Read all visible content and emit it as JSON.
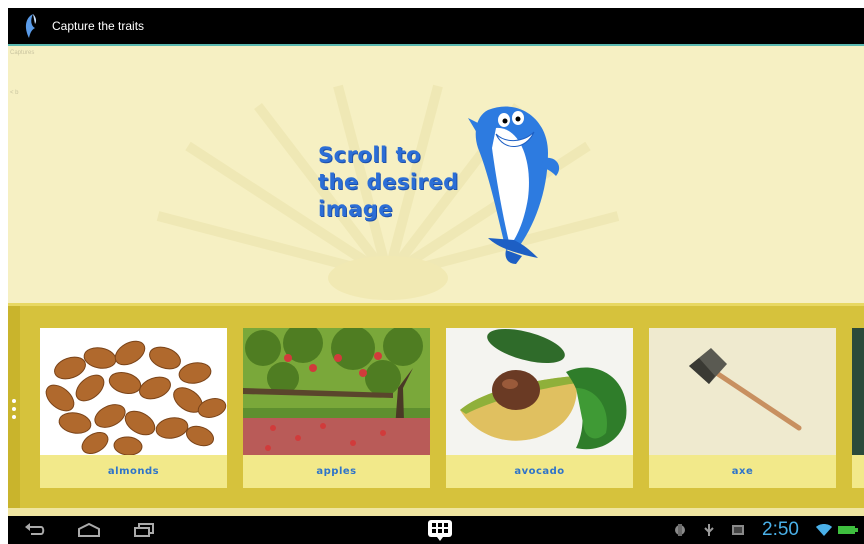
{
  "actionbar": {
    "title": "Capture the traits",
    "icon": "dolphin-app-icon"
  },
  "ghost": {
    "top_text": "Captures",
    "side_text": "< b"
  },
  "hero": {
    "lines": [
      "Scroll to",
      "the desired",
      "image"
    ],
    "mascot": "shark-mascot"
  },
  "cards": [
    {
      "label": "almonds",
      "image": "almonds-photo"
    },
    {
      "label": "apples",
      "image": "apple-tree-photo"
    },
    {
      "label": "avocado",
      "image": "avocado-photo"
    },
    {
      "label": "axe",
      "image": "axe-photo"
    }
  ],
  "statusbar": {
    "time": "2:50"
  },
  "colors": {
    "accent": "#5ab8b0",
    "background": "#f6f0c3",
    "strip": "#d6c23c",
    "label": "#2f74c9",
    "clock": "#4ab0e8"
  }
}
